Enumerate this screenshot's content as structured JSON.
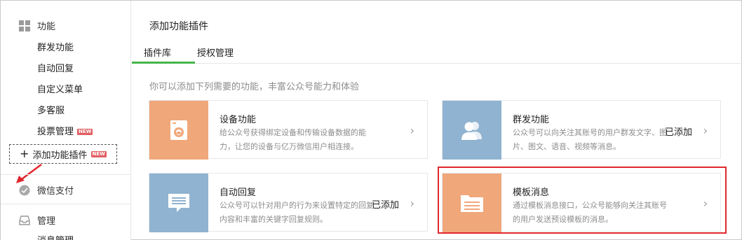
{
  "sidebar": {
    "group_function": "功能",
    "items": [
      {
        "label": "群发功能",
        "new": false
      },
      {
        "label": "自动回复",
        "new": false
      },
      {
        "label": "自定义菜单",
        "new": false
      },
      {
        "label": "多客服",
        "new": false
      },
      {
        "label": "投票管理",
        "new": true
      }
    ],
    "add_plugin_label": "添加功能插件",
    "new_badge": "NEW",
    "group_wechat_pay": "微信支付",
    "group_manage": "管理",
    "manage_item_partial": "消息管理"
  },
  "main": {
    "page_title": "添加功能插件",
    "tabs": [
      {
        "label": "插件库",
        "active": true
      },
      {
        "label": "授权管理",
        "active": false
      }
    ],
    "intro": "你可以添加下列需要的功能，丰富公众号能力和体验",
    "cards": [
      {
        "title": "设备功能",
        "desc": "给公众号获得绑定设备和传输设备数据的能力，让您的设备与亿万微信用户相连接。",
        "status": "",
        "icon": "washing-machine-icon",
        "color": "#f0a77a"
      },
      {
        "title": "群发功能",
        "desc": "公众号可以向关注其账号的用户群发文字、图片、图文、语音、视频等消息。",
        "status": "已添加",
        "icon": "users-icon",
        "color": "#8fb3d0"
      },
      {
        "title": "自动回复",
        "desc": "公众号可以针对用户的行为来设置特定的回复内容和丰富的关键字回复规则。",
        "status": "已添加",
        "icon": "chat-bubble-icon",
        "color": "#8fb3d0"
      },
      {
        "title": "模板消息",
        "desc": "通过模板消息接口，公众号能够向关注其账号的用户发送预设模板的消息。",
        "status": "",
        "icon": "folder-icon",
        "color": "#f0a77a"
      }
    ]
  },
  "colors": {
    "accent_green": "#44b549",
    "highlight_red": "#e0272d",
    "badge_red": "#e15f63"
  }
}
